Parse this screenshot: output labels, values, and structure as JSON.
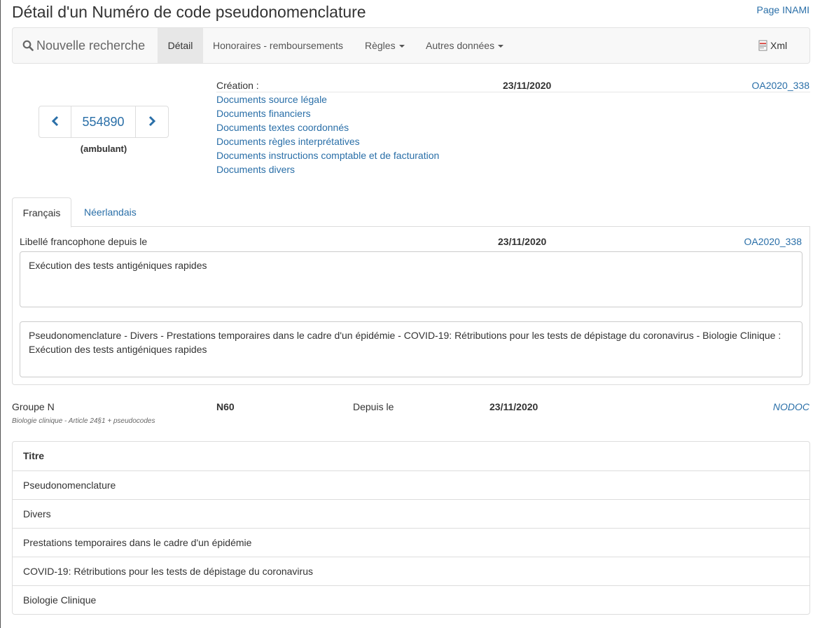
{
  "header": {
    "title": "Détail d'un Numéro de code pseudonomenclature",
    "page_link": "Page INAMI"
  },
  "nav": {
    "search_label": "Nouvelle recherche",
    "detail_label": "Détail",
    "honoraires_label": "Honoraires - remboursements",
    "regles_label": "Règles",
    "autres_label": "Autres données",
    "xml_label": "Xml"
  },
  "code": {
    "value": "554890",
    "type": "(ambulant)"
  },
  "creation": {
    "label": "Création :",
    "date": "23/11/2020",
    "ref": "OA2020_338",
    "documents": [
      "Documents source légale",
      "Documents financiers",
      "Documents textes coordonnés",
      "Documents règles interprétatives",
      "Documents instructions comptable et de facturation",
      "Documents divers"
    ]
  },
  "tabs": {
    "fr": "Français",
    "nl": "Néerlandais"
  },
  "libelle": {
    "label": "Libellé francophone depuis le",
    "date": "23/11/2020",
    "ref": "OA2020_338",
    "short_text": "Exécution des tests antigéniques rapides",
    "long_text": "Pseudonomenclature - Divers - Prestations temporaires dans le cadre d'un épidémie - COVID-19: Rétributions pour les tests de dépistage du coronavirus - Biologie Clinique : Exécution des tests antigéniques rapides"
  },
  "groupe": {
    "label": "Groupe N",
    "code": "N60",
    "since_label": "Depuis le",
    "date": "23/11/2020",
    "ref": "NODOC",
    "description": "Biologie clinique - Article 24§1 + pseudocodes"
  },
  "titre_table": {
    "header": "Titre",
    "rows": [
      "Pseudonomenclature",
      "Divers",
      "Prestations temporaires dans le cadre d'un épidémie",
      "COVID-19: Rétributions pour les tests de dépistage du coronavirus",
      "Biologie Clinique"
    ]
  },
  "colors": {
    "link": "#2a6fa8",
    "navbar_bg": "#f8f8f8",
    "active_nav_bg": "#e7e7e7",
    "border": "#dddddd"
  },
  "icons": {
    "search": "search-icon",
    "prev": "chevron-left-icon",
    "next": "chevron-right-icon",
    "xml": "xml-file-icon"
  }
}
